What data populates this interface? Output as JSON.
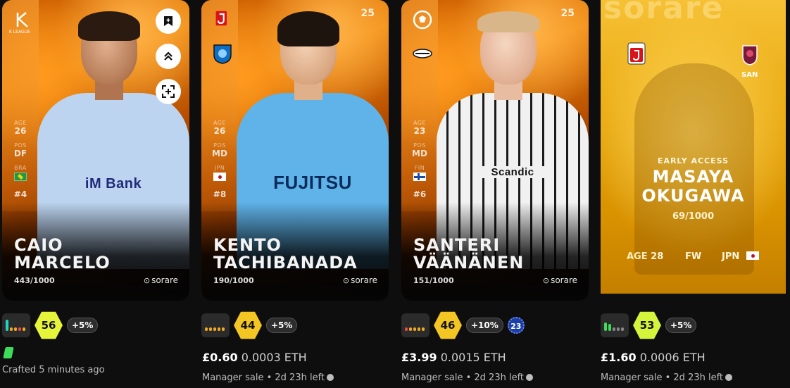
{
  "cards": [
    {
      "first_name": "CAIO",
      "last_name": "MARCELO",
      "serial": "443/1000",
      "brand": "sorare",
      "league_label": "K LEAGUE",
      "age_label": "AGE",
      "age": "26",
      "pos_label": "POS",
      "pos": "DF",
      "country": "BRA",
      "number": "#4",
      "sponsor": "iM Bank",
      "kit_color": "#bcd4ef",
      "score": "56",
      "score_color": "#e6f43a",
      "bonus": "+5%",
      "crafted": "Crafted 5 minutes ago"
    },
    {
      "first_name": "KENTO",
      "last_name": "TACHIBANADA",
      "serial": "190/1000",
      "brand": "sorare",
      "edition": "25",
      "age_label": "AGE",
      "age": "26",
      "pos_label": "POS",
      "pos": "MD",
      "country": "JPN",
      "number": "#8",
      "sponsor": "FUJITSU",
      "kit_color": "#5fb3e8",
      "score": "44",
      "score_color": "#f3c623",
      "bonus": "+5%",
      "price_gbp": "£0.60",
      "price_eth": "0.0003 ETH",
      "sale": "Manager sale • 2d 23h left"
    },
    {
      "first_name": "SANTERI",
      "last_name": "VÄÄNÄNEN",
      "serial": "151/1000",
      "brand": "sorare",
      "edition": "25",
      "age_label": "AGE",
      "age": "23",
      "pos_label": "POS",
      "pos": "MD",
      "country": "FIN",
      "number": "#6",
      "sponsor": "Scandic",
      "kit_color": "#f1f1f1",
      "score": "46",
      "score_color": "#f3c623",
      "bonus": "+10%",
      "level": "23",
      "price_gbp": "£3.99",
      "price_eth": "0.0015 ETH",
      "sale": "Manager sale • 2d 23h left"
    }
  ],
  "pack": {
    "brand": "sorare",
    "club_code": "SAN",
    "label": "EARLY ACCESS",
    "first_name": "MASAYA",
    "last_name": "OKUGAWA",
    "serial": "69/1000",
    "age_label": "AGE",
    "age": "28",
    "pos": "FW",
    "country": "JPN",
    "score": "53",
    "score_color": "#d4f53c",
    "bonus": "+5%",
    "price_gbp": "£1.60",
    "price_eth": "0.0006 ETH",
    "sale": "Manager sale • 2d 23h left"
  },
  "icons": {
    "watchlist": "bookmark-icon",
    "level_up": "chevrons-up-icon",
    "scan": "scan-icon",
    "clock": "clock-icon"
  }
}
